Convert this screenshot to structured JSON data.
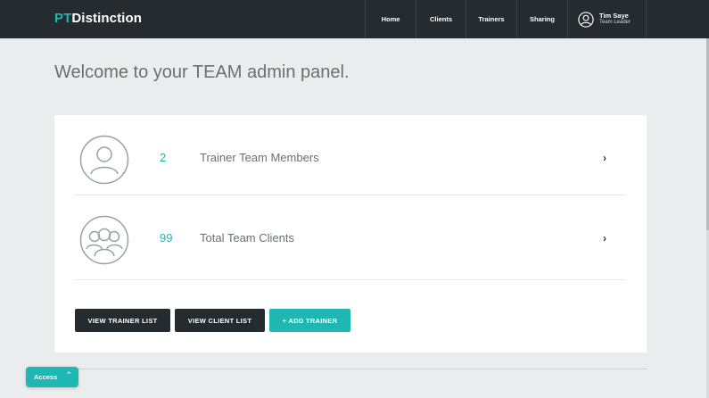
{
  "header": {
    "logo_pt": "PT",
    "logo_rest": "Distinction",
    "nav": {
      "home": "Home",
      "clients": "Clients",
      "trainers": "Trainers",
      "sharing": "Sharing"
    },
    "user": {
      "name": "Tim Saye",
      "role": "Team Leader"
    }
  },
  "main": {
    "welcome": "Welcome to your TEAM admin panel.",
    "stats": [
      {
        "count": "2",
        "label": "Trainer Team Members",
        "chevron": "›"
      },
      {
        "count": "99",
        "label": "Total Team Clients",
        "chevron": "›"
      }
    ],
    "buttons": {
      "trainer_list": "VIEW TRAINER LIST",
      "client_list": "VIEW CLIENT LIST",
      "add_trainer": "+ ADD TRAINER"
    }
  },
  "access": {
    "label": "Access",
    "chevron": "⌃"
  },
  "colors": {
    "accent": "#1fb7b1",
    "dark": "#262b2f",
    "background": "#ebecee"
  },
  "icons": {
    "user": "user-circle-icon",
    "member": "person-circle-icon",
    "group": "group-circle-icon"
  }
}
